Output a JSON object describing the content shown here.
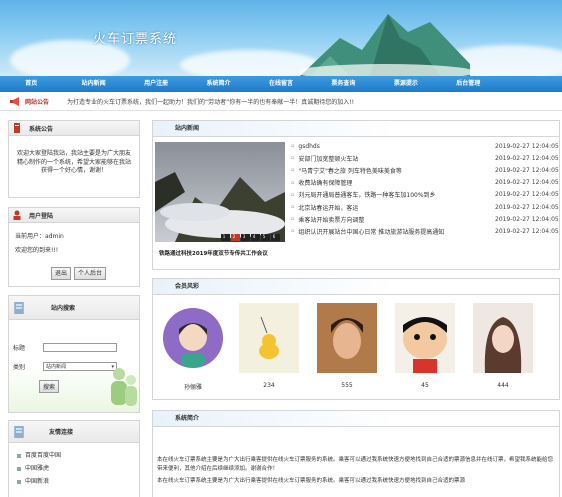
{
  "header": {
    "title": "火车订票系统"
  },
  "nav": {
    "items": [
      "首页",
      "站内新闻",
      "用户注册",
      "系统简介",
      "在线留言",
      "票务查询",
      "票源提示",
      "后台管理"
    ]
  },
  "notice_bar": {
    "label": "网站公告",
    "text": "为打造专业的火车订票系统，我们一起助力！我们的“劳动者”你有一半的也有奉献一半！真诚期待您的加入!!"
  },
  "sidebar": {
    "announce": {
      "title": "系统公告",
      "text": "欢迎大家登陆我站，我站主要是为广大朋友精心制作的一个系统，希望大家能够在我站获得一个好心情，谢谢！"
    },
    "login": {
      "title": "用户登陆",
      "current_user_label": "当前用户：",
      "current_user": "admin",
      "welcome": "欢迎您的到来!!!",
      "logout_label": "退出",
      "center_label": "个人后台"
    },
    "search": {
      "title": "站内搜索",
      "field_label": "标题",
      "category_label": "类别",
      "category_value": "站内新闻",
      "search_button": "搜索"
    },
    "links": {
      "title": "友情连接",
      "items": [
        "百度百度中国",
        "中国雅虎",
        "中国新浪"
      ]
    }
  },
  "news": {
    "title": "站内新闻",
    "photo_caption": "铁路通过科技2019年度双节专传共工作会议",
    "slide_pages": [
      "1",
      "2",
      "3",
      "4",
      "5",
      "6"
    ],
    "items": [
      {
        "title": "gsdhds",
        "date": "2019-02-27 12:04:05"
      },
      {
        "title": "安部门加宽整顿火车站",
        "date": "2019-02-27 12:04:05"
      },
      {
        "title": "\"马青宁艾\"春之旅 列车特色美味美食等",
        "date": "2019-02-27 12:04:05"
      },
      {
        "title": "收费站确有保障管理",
        "date": "2019-02-27 12:04:05"
      },
      {
        "title": "刘元局开通局普通客车，铁路一种客车加100%到乡",
        "date": "2019-02-27 12:04:05"
      },
      {
        "title": "北京站春运开始，客运",
        "date": "2019-02-27 12:04:05"
      },
      {
        "title": "乘客站开始卖票方向调整",
        "date": "2019-02-27 12:04:05"
      },
      {
        "title": "组织认识开展站台中国心日常 推动旅游站服务提高通知",
        "date": "2019-02-27 12:04:05"
      }
    ]
  },
  "members": {
    "title": "会员风彩",
    "items": [
      {
        "name": "孙俪雅"
      },
      {
        "name": "234"
      },
      {
        "name": "555"
      },
      {
        "name": "45"
      },
      {
        "name": "444"
      }
    ]
  },
  "intro": {
    "title": "系统简介",
    "text": "本在线火车订票系统主要是为广大出行乘客提供在线火车订票服务的系统。乘客可以通过我系统快速方便地找到自己合适的票源信息并在线订票，希望我系统能给您带来便利，其他介绍在后续继续添加。谢谢合作！",
    "text2": "本在线火车订票系统主要是为广大出行乘客提供在线火车订票服务的系统。乘客可以通过我系统快速方便地找到自己合适的票源"
  },
  "colors": {
    "nav": "#1f7bc9",
    "notice_label": "#c0392b"
  }
}
